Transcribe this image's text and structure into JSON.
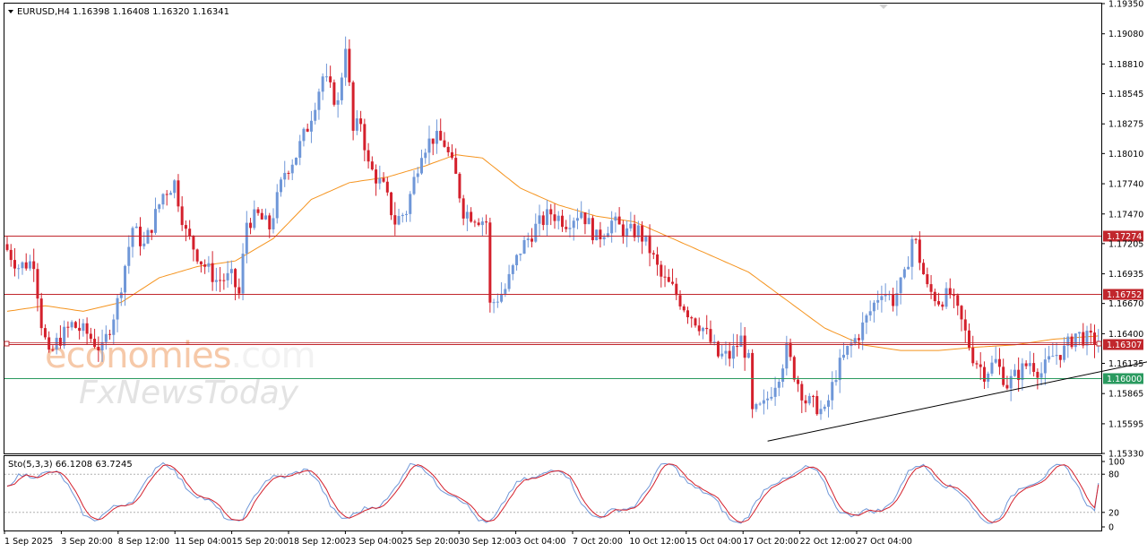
{
  "header": {
    "title": "EURUSD,H4",
    "ohlc": "1.16398 1.16408 1.16320 1.16341",
    "stoch_title": "Sto(5,3,3) 66.1208 63.7245"
  },
  "watermark": {
    "brand1_a": "economies",
    "brand1_b": ".com",
    "brand2": "FxNewsToday"
  },
  "colors": {
    "bull": "#6f97d8",
    "bear": "#d4202c",
    "ma": "#f5941f",
    "resistance": "#c1272d",
    "support": "#2a9a5f",
    "trendline": "#000000",
    "stoch_main": "#6f97d8",
    "stoch_signal": "#d4202c"
  },
  "chart_data": {
    "type": "candlestick",
    "symbol": "EURUSD",
    "timeframe": "H4",
    "ylim": [
      1.1533,
      1.1935
    ],
    "y_ticks": [
      "1.19350",
      "1.19080",
      "1.18810",
      "1.18545",
      "1.18275",
      "1.18010",
      "1.17740",
      "1.17470",
      "1.17205",
      "1.16935",
      "1.16670",
      "1.16400",
      "1.16135",
      "1.15865",
      "1.15595",
      "1.15330"
    ],
    "x_ticks": [
      "1 Sep 2025",
      "3 Sep 20:00",
      "8 Sep 12:00",
      "11 Sep 04:00",
      "15 Sep 20:00",
      "18 Sep 12:00",
      "23 Sep 04:00",
      "25 Sep 20:00",
      "30 Sep 12:00",
      "3 Oct 04:00",
      "7 Oct 20:00",
      "10 Oct 12:00",
      "15 Oct 04:00",
      "17 Oct 20:00",
      "22 Oct 12:00",
      "27 Oct 04:00"
    ],
    "price_path": [
      [
        0,
        1.172
      ],
      [
        4,
        1.17
      ],
      [
        8,
        1.1705
      ],
      [
        10,
        1.165
      ],
      [
        12,
        1.1618
      ],
      [
        14,
        1.1632
      ],
      [
        18,
        1.1648
      ],
      [
        22,
        1.164
      ],
      [
        26,
        1.1625
      ],
      [
        30,
        1.1668
      ],
      [
        34,
        1.1735
      ],
      [
        37,
        1.1718
      ],
      [
        42,
        1.1765
      ],
      [
        45,
        1.1775
      ],
      [
        48,
        1.173
      ],
      [
        52,
        1.1705
      ],
      [
        56,
        1.1688
      ],
      [
        60,
        1.169
      ],
      [
        62,
        1.1675
      ],
      [
        64,
        1.174
      ],
      [
        67,
        1.1745
      ],
      [
        70,
        1.1735
      ],
      [
        74,
        1.1785
      ],
      [
        77,
        1.18
      ],
      [
        80,
        1.1825
      ],
      [
        84,
        1.187
      ],
      [
        88,
        1.1845
      ],
      [
        90,
        1.19
      ],
      [
        92,
        1.182
      ],
      [
        94,
        1.183
      ],
      [
        96,
        1.179
      ],
      [
        100,
        1.177
      ],
      [
        103,
        1.174
      ],
      [
        106,
        1.175
      ],
      [
        110,
        1.1805
      ],
      [
        113,
        1.1815
      ],
      [
        116,
        1.181
      ],
      [
        119,
        1.178
      ],
      [
        121,
        1.175
      ],
      [
        124,
        1.1745
      ],
      [
        127,
        1.174
      ],
      [
        128,
        1.1665
      ],
      [
        132,
        1.168
      ],
      [
        136,
        1.1715
      ],
      [
        140,
        1.1735
      ],
      [
        144,
        1.1748
      ],
      [
        148,
        1.174
      ],
      [
        152,
        1.175
      ],
      [
        156,
        1.1725
      ],
      [
        160,
        1.174
      ],
      [
        164,
        1.173
      ],
      [
        167,
        1.1732
      ],
      [
        170,
        1.1715
      ],
      [
        173,
        1.169
      ],
      [
        176,
        1.168
      ],
      [
        180,
        1.166
      ],
      [
        184,
        1.1645
      ],
      [
        188,
        1.162
      ],
      [
        191,
        1.162
      ],
      [
        194,
        1.1635
      ],
      [
        196,
        1.1615
      ],
      [
        197,
        1.1568
      ],
      [
        200,
        1.1575
      ],
      [
        204,
        1.1605
      ],
      [
        206,
        1.1625
      ],
      [
        208,
        1.1605
      ],
      [
        211,
        1.158
      ],
      [
        214,
        1.1575
      ],
      [
        216,
        1.1568
      ],
      [
        219,
        1.1605
      ],
      [
        222,
        1.1625
      ],
      [
        225,
        1.164
      ],
      [
        228,
        1.166
      ],
      [
        231,
        1.168
      ],
      [
        234,
        1.167
      ],
      [
        237,
        1.169
      ],
      [
        239,
        1.1725
      ],
      [
        240,
        1.172
      ],
      [
        243,
        1.168
      ],
      [
        246,
        1.167
      ],
      [
        249,
        1.1675
      ],
      [
        252,
        1.165
      ],
      [
        255,
        1.162
      ],
      [
        258,
        1.1605
      ],
      [
        261,
        1.1615
      ],
      [
        264,
        1.1595
      ],
      [
        267,
        1.1605
      ],
      [
        270,
        1.1615
      ],
      [
        273,
        1.1605
      ],
      [
        276,
        1.162
      ],
      [
        279,
        1.1625
      ],
      [
        282,
        1.164
      ],
      [
        285,
        1.1635
      ],
      [
        287,
        1.1634
      ]
    ],
    "moving_average_path": [
      [
        0,
        1.166
      ],
      [
        10,
        1.1665
      ],
      [
        20,
        1.166
      ],
      [
        30,
        1.1668
      ],
      [
        40,
        1.169
      ],
      [
        50,
        1.17
      ],
      [
        60,
        1.1705
      ],
      [
        70,
        1.1725
      ],
      [
        80,
        1.176
      ],
      [
        90,
        1.1775
      ],
      [
        100,
        1.178
      ],
      [
        110,
        1.179
      ],
      [
        118,
        1.18
      ],
      [
        125,
        1.1797
      ],
      [
        135,
        1.177
      ],
      [
        145,
        1.1755
      ],
      [
        155,
        1.1745
      ],
      [
        165,
        1.174
      ],
      [
        175,
        1.1725
      ],
      [
        185,
        1.171
      ],
      [
        195,
        1.1695
      ],
      [
        205,
        1.167
      ],
      [
        215,
        1.1645
      ],
      [
        225,
        1.163
      ],
      [
        235,
        1.1625
      ],
      [
        245,
        1.1625
      ],
      [
        255,
        1.1628
      ],
      [
        265,
        1.163
      ],
      [
        275,
        1.1635
      ],
      [
        287,
        1.1638
      ]
    ],
    "horizontal_levels": [
      {
        "value": "1.17274",
        "role": "resistance"
      },
      {
        "value": "1.16752",
        "role": "resistance"
      },
      {
        "value": "1.16307",
        "role": "current"
      },
      {
        "value": "1.16000",
        "role": "support"
      }
    ],
    "trendline": {
      "from": [
        200,
        1.1544
      ],
      "to": [
        310,
        1.1622
      ]
    },
    "stochastic": {
      "params": "5,3,3",
      "main": 66.1208,
      "signal": 63.7245,
      "levels": [
        20,
        80
      ],
      "y_ticks": [
        "100",
        "80",
        "20",
        "0"
      ]
    }
  }
}
